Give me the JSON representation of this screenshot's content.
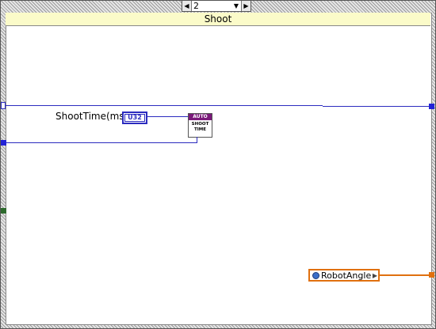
{
  "case_selector": {
    "value": "2",
    "left_arrow": "◀",
    "right_arrow": "▶",
    "dropdown": "▼"
  },
  "case_label": "Shoot",
  "constant": {
    "label": "ShootTime(ms)",
    "type": "U32"
  },
  "subvi": {
    "header": "AUTO",
    "line1": "SHOOT",
    "line2": "TIME"
  },
  "local_var": {
    "label": "RobotAngle",
    "arrow": "▶"
  },
  "colors": {
    "wire_blue": "#2b2bbf",
    "wire_orange": "#e0700f",
    "case_label_bg": "#fbfbc9",
    "subvi_header": "#7a1a7a"
  }
}
